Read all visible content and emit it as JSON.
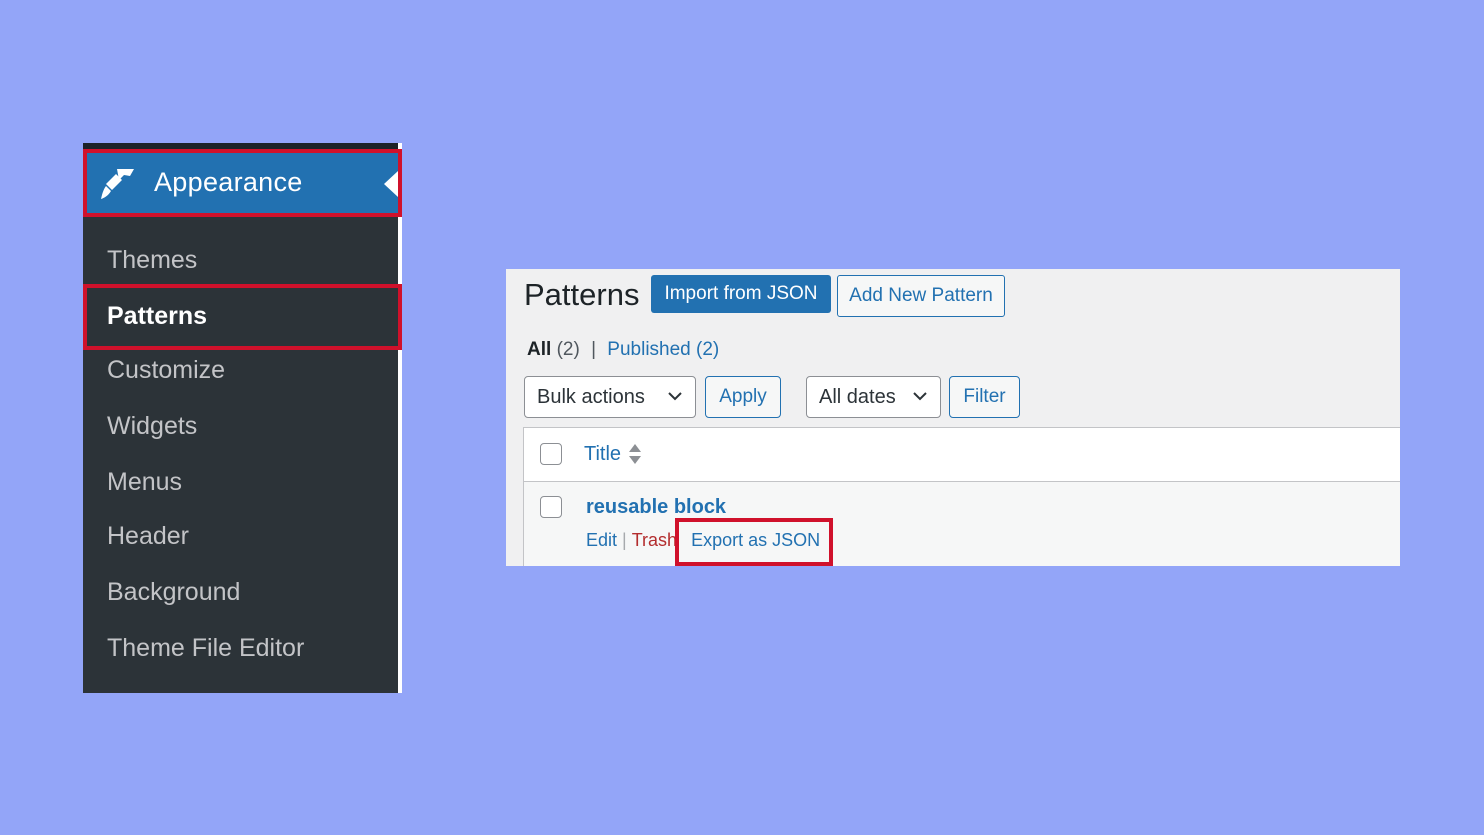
{
  "sidebar": {
    "menu_label": "Appearance",
    "icon": "paintbrush-icon",
    "items": [
      {
        "label": "Themes",
        "current": false
      },
      {
        "label": "Patterns",
        "current": true
      },
      {
        "label": "Customize",
        "current": false
      },
      {
        "label": "Widgets",
        "current": false
      },
      {
        "label": "Menus",
        "current": false
      },
      {
        "label": "Header",
        "current": false
      },
      {
        "label": "Background",
        "current": false
      },
      {
        "label": "Theme File Editor",
        "current": false
      }
    ]
  },
  "patterns": {
    "title": "Patterns",
    "import_label": "Import from JSON",
    "add_new_label": "Add New Pattern",
    "views": {
      "all_label": "All",
      "all_count": "(2)",
      "separator": "|",
      "published_label": "Published",
      "published_count": "(2)"
    },
    "bulk_actions_label": "Bulk actions",
    "apply_label": "Apply",
    "dates_label": "All dates",
    "filter_label": "Filter",
    "column_title": "Title",
    "row": {
      "title": "reusable block",
      "edit_label": "Edit",
      "sep": "|",
      "trash_label": "Trash",
      "export_label": "Export as JSON"
    }
  },
  "colors": {
    "background": "#93a5f8",
    "sidebar_bg": "#2c3338",
    "accent": "#2271b1",
    "highlight": "#d0112b",
    "trash": "#b32d2e"
  }
}
